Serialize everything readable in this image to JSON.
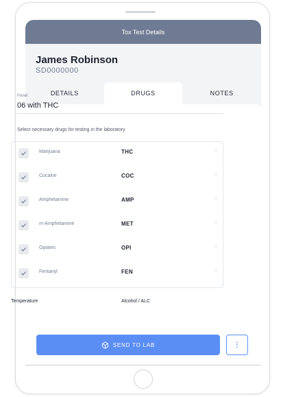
{
  "header": {
    "title": "Tox Test Details"
  },
  "patient": {
    "name": "James Robinson",
    "id": "SD0000000"
  },
  "tabs": [
    {
      "label": "DETAILS",
      "active": false
    },
    {
      "label": "DRUGS",
      "active": true
    },
    {
      "label": "NOTES",
      "active": false
    }
  ],
  "panel": {
    "label": "Panel",
    "value": "06 with THC"
  },
  "instructions": "Select necessary drugs for testing in the laboratory",
  "drugs": [
    {
      "name": "Marijuana",
      "code": "THC",
      "result": "--",
      "checked": true
    },
    {
      "name": "Cocaine",
      "code": "COC",
      "result": "--",
      "checked": true
    },
    {
      "name": "Amphetamine",
      "code": "AMP",
      "result": "--",
      "checked": true
    },
    {
      "name": "m-Amphetamine",
      "code": "MET",
      "result": "--",
      "checked": true
    },
    {
      "name": "Opiates",
      "code": "OPI",
      "result": "--",
      "checked": true
    },
    {
      "name": "Fentanyl",
      "code": "FEN",
      "result": "--",
      "checked": true
    }
  ],
  "fields": {
    "temperature_label": "Temperature",
    "alcohol_label": "Alcohol / ALC"
  },
  "actions": {
    "send_label": "SEND TO LAB",
    "more_label": "⋮"
  },
  "colors": {
    "header": "#6f7b93",
    "accent": "#5b8ef5",
    "screen_bg": "#f3f4f6"
  },
  "icons": {
    "checkbox": "check-icon",
    "send": "package-icon",
    "more": "more-vertical-icon"
  }
}
